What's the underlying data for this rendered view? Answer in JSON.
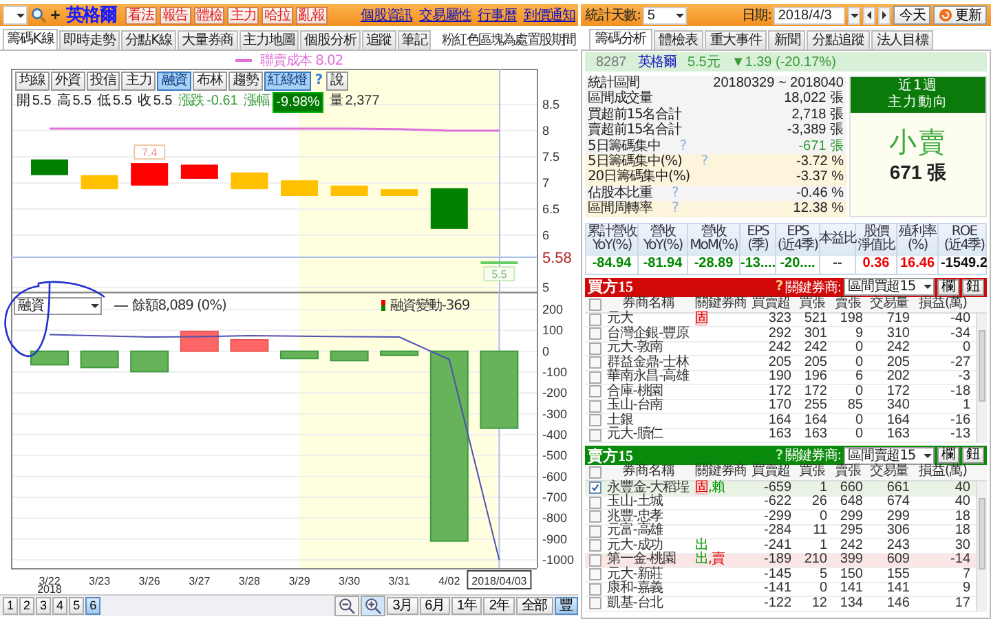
{
  "left": {
    "header": {
      "plus": "+",
      "title": "英格爾",
      "buttons": [
        "看法",
        "報告",
        "體檢",
        "主力",
        "哈拉",
        "亂報"
      ],
      "links": [
        "個股資訊",
        "交易屬性",
        "行事曆",
        "到價通知"
      ]
    },
    "tabs": [
      {
        "label": "籌碼K線",
        "selected": true
      },
      {
        "label": "即時走勢",
        "selected": false
      },
      {
        "label": "分點K線",
        "selected": false
      },
      {
        "label": "大量券商",
        "selected": false
      },
      {
        "label": "主力地圖",
        "selected": false
      },
      {
        "label": "個股分析",
        "selected": false
      },
      {
        "label": "追蹤",
        "selected": false
      },
      {
        "label": "筆記",
        "selected": false
      }
    ],
    "note": "粉紅色區塊為處置股期間",
    "legend": "聯賣成本 8.02",
    "chart_buttons": [
      {
        "label": "均線",
        "selected": false
      },
      {
        "label": "外資",
        "selected": false
      },
      {
        "label": "投信",
        "selected": false
      },
      {
        "label": "主力",
        "selected": false
      },
      {
        "label": "融資",
        "selected": true
      },
      {
        "label": "布林",
        "selected": false
      },
      {
        "label": "趨勢",
        "selected": false
      },
      {
        "label": "紅綠燈",
        "selected": true
      },
      {
        "label": "?",
        "kind": "help"
      },
      {
        "label": "說",
        "selected": false
      }
    ],
    "quote": [
      {
        "label": "開",
        "value": "5.5",
        "kind": "plain"
      },
      {
        "label": "高",
        "value": "5.5",
        "kind": "plain"
      },
      {
        "label": "低",
        "value": "5.5",
        "kind": "plain"
      },
      {
        "label": "收",
        "value": "5.5",
        "kind": "plain"
      },
      {
        "label": "漲跌",
        "value": "-0.61",
        "kind": "down"
      },
      {
        "label": "漲幅",
        "value": "-9.98%",
        "kind": "down_box"
      },
      {
        "label": "量",
        "value": "2,377",
        "kind": "volume"
      }
    ],
    "price_chart": {
      "axis_labels": [
        "8.5",
        "8",
        "7.5",
        "7",
        "6.5",
        "6",
        "5"
      ],
      "high_tag": "7.4",
      "last_tag": "5.5",
      "price_line": "5.58"
    },
    "margin_chart": {
      "select": "融資",
      "balance": "8,089 (0%)",
      "change": "-369",
      "chart_data": {
        "type": "bar",
        "categories": [
          "3/22",
          "3/23",
          "3/26",
          "3/27",
          "3/28",
          "3/29",
          "3/30",
          "3/31",
          "4/02",
          "2018/04/03"
        ],
        "series": [
          {
            "name": "融資變動",
            "colors": [
              "#66b35a",
              "#66b35a",
              "#66b35a",
              "#ff6666",
              "#ff6666",
              "#66b35a",
              "#66b35a",
              "#66b35a",
              "#66b35a",
              "#66b35a"
            ],
            "values": [
              -65,
              -78,
              -98,
              95,
              55,
              -35,
              -45,
              -20,
              -910,
              -369
            ]
          },
          {
            "name": "餘額",
            "type": "line",
            "color": "#5050b0",
            "values": [
              80,
              74,
              68,
              70,
              75,
              72,
              70,
              68,
              -40,
              -1000
            ]
          }
        ],
        "grid": true,
        "bands": [
          {
            "axis": "x",
            "from": "3/29",
            "to": "2018/04/03",
            "color": "#ffffe0"
          }
        ],
        "ref_lines": [
          {
            "axis": "x",
            "value": "2018/04/03",
            "color": "#a8c0e8"
          }
        ],
        "ylim": [
          -1000,
          200
        ],
        "yticks": [
          200,
          100,
          0,
          -100,
          -200,
          -300,
          -400,
          -500,
          -600,
          -700,
          -800,
          -900,
          -1000
        ]
      },
      "year": "2018"
    },
    "pages": [
      {
        "label": "1",
        "selected": false
      },
      {
        "label": "2",
        "selected": false
      },
      {
        "label": "3",
        "selected": false
      },
      {
        "label": "4",
        "selected": false
      },
      {
        "label": "5",
        "selected": false
      },
      {
        "label": "6",
        "selected": true
      }
    ],
    "ranges": [
      {
        "label": "3月",
        "selected": false
      },
      {
        "label": "6月",
        "selected": false
      },
      {
        "label": "1年",
        "selected": false
      },
      {
        "label": "2年",
        "selected": false
      },
      {
        "label": "全部",
        "selected": false
      },
      {
        "label": "豐",
        "selected": true
      }
    ]
  },
  "right": {
    "days_label": "統計天數:",
    "days": "5",
    "date_label": "日期:",
    "date": "2018/4/3",
    "today": "今天",
    "refresh": "更新",
    "tabs": [
      {
        "label": "籌碼分析",
        "selected": true
      },
      {
        "label": "體檢表",
        "selected": false
      },
      {
        "label": "重大事件",
        "selected": false
      },
      {
        "label": "新聞",
        "selected": false
      },
      {
        "label": "分點追蹤",
        "selected": false
      },
      {
        "label": "法人目標",
        "selected": false
      }
    ],
    "stock": {
      "code": "8287",
      "name": "英格爾",
      "price": "5.5元",
      "change": "▼1.39 (-20.17%)"
    },
    "stats": [
      {
        "label": "統計區間",
        "value": "20180329 ~ 2018040",
        "highlight": false,
        "color": "#222222"
      },
      {
        "label": "區間成交量",
        "value": "18,022 張",
        "highlight": false,
        "color": "#222222"
      },
      {
        "label": "買超前15名合計",
        "value": "2,718 張",
        "highlight": false,
        "color": "#222222"
      },
      {
        "label": "賣超前15名合計",
        "value": "-3,389 張",
        "highlight": false,
        "color": "#222222"
      },
      {
        "label": "5日籌碼集中",
        "help": "?",
        "value": "-671 張",
        "highlight": false,
        "color": "#339933"
      },
      {
        "label": "5日籌碼集中(%)",
        "help": "?",
        "value": "-3.72 %",
        "highlight": true,
        "color": "#222222"
      },
      {
        "label": "20日籌碼集中(%)",
        "value": "-3.37 %",
        "highlight": true,
        "color": "#222222"
      },
      {
        "label": "佔股本比重",
        "help": "?",
        "value": "-0.46 %",
        "highlight": false,
        "color": "#222222"
      },
      {
        "label": "區間周轉率",
        "help": "?",
        "value": "12.38 %",
        "highlight": true,
        "color": "#222222"
      }
    ],
    "trend": {
      "period": "近1週",
      "title": "主力動向",
      "verdict": "小賣",
      "amount": "671 張"
    },
    "fundamentals": [
      {
        "header": [
          "累計營收",
          "YoY(%)"
        ],
        "value": "-84.94",
        "color": "#008800"
      },
      {
        "header": [
          "營收",
          "YoY(%)"
        ],
        "value": "-81.94",
        "color": "#008800"
      },
      {
        "header": [
          "營收",
          "MoM(%)"
        ],
        "value": "-28.89",
        "color": "#008800"
      },
      {
        "header": [
          "EPS",
          "(季)"
        ],
        "value": "-13....",
        "color": "#008800"
      },
      {
        "header": [
          "EPS",
          "(近4季)"
        ],
        "value": "-20....",
        "color": "#008800"
      },
      {
        "header": [
          "本益比"
        ],
        "value": "--",
        "color": "#444444"
      },
      {
        "header": [
          "股價",
          "淨值比"
        ],
        "value": "0.36",
        "color": "#ee0000"
      },
      {
        "header": [
          "殖利率",
          "(%)"
        ],
        "value": "16.46",
        "color": "#ee0000"
      },
      {
        "header": [
          "ROE",
          "(近4季)"
        ],
        "value": "-1549.2",
        "color": "#111111"
      }
    ],
    "tables": [
      {
        "kind": "buy",
        "title": "買方15",
        "help": "?",
        "key_label": "關鍵券商:",
        "select": "區間買超15",
        "buttons": [
          "欄",
          "鈕"
        ],
        "header_checked": false,
        "columns": [
          "券商名稱",
          "關鍵券商",
          "買賣超",
          "買張",
          "賣張",
          "交易量",
          "損益(萬)"
        ],
        "rows": [
          {
            "name": "元大",
            "tags": [
              {
                "text": "固",
                "color": "#e00000"
              }
            ],
            "net": "323",
            "buy": "521",
            "sell": "198",
            "volume": "719",
            "pnl": "-40",
            "checked": false
          },
          {
            "name": "台灣企銀-豐原",
            "net": "292",
            "buy": "301",
            "sell": "9",
            "volume": "310",
            "pnl": "-34",
            "checked": false
          },
          {
            "name": "元大-敦南",
            "net": "242",
            "buy": "242",
            "sell": "0",
            "volume": "242",
            "pnl": "0",
            "checked": false
          },
          {
            "name": "群益金鼎-士林",
            "net": "205",
            "buy": "205",
            "sell": "0",
            "volume": "205",
            "pnl": "-27",
            "checked": false
          },
          {
            "name": "華南永昌-高雄",
            "net": "190",
            "buy": "196",
            "sell": "6",
            "volume": "202",
            "pnl": "-3",
            "checked": false
          },
          {
            "name": "合庫-桃園",
            "net": "172",
            "buy": "172",
            "sell": "0",
            "volume": "172",
            "pnl": "-18",
            "checked": false
          },
          {
            "name": "玉山-台南",
            "net": "170",
            "buy": "255",
            "sell": "85",
            "volume": "340",
            "pnl": "1",
            "checked": false
          },
          {
            "name": "土銀",
            "net": "164",
            "buy": "164",
            "sell": "0",
            "volume": "164",
            "pnl": "-16",
            "checked": false
          },
          {
            "name": "元大-贖仁",
            "net": "163",
            "buy": "163",
            "sell": "0",
            "volume": "163",
            "pnl": "-13",
            "checked": false
          }
        ]
      },
      {
        "kind": "sell",
        "title": "賣方15",
        "help": "?",
        "key_label": "關鍵券商:",
        "select": "區間賣超15",
        "buttons": [
          "欄",
          "鈕"
        ],
        "header_checked": false,
        "columns": [
          "券商名稱",
          "關鍵券商",
          "買賣超",
          "買張",
          "賣張",
          "交易量",
          "損益(萬)"
        ],
        "rows": [
          {
            "name": "永豐金-大稻埕",
            "tags": [
              {
                "text": "固",
                "color": "#e00000"
              },
              {
                "text": ",賴",
                "color": "#009900"
              }
            ],
            "net": "-659",
            "buy": "1",
            "sell": "660",
            "volume": "661",
            "pnl": "40",
            "checked": true,
            "color": "#e8f3e4"
          },
          {
            "name": "玉山-土城",
            "net": "-622",
            "buy": "26",
            "sell": "648",
            "volume": "674",
            "pnl": "40",
            "checked": false
          },
          {
            "name": "兆豐-忠孝",
            "net": "-299",
            "buy": "0",
            "sell": "299",
            "volume": "299",
            "pnl": "18",
            "checked": false
          },
          {
            "name": "元富-高雄",
            "net": "-284",
            "buy": "11",
            "sell": "295",
            "volume": "306",
            "pnl": "18",
            "checked": false
          },
          {
            "name": "元大-成功",
            "tags": [
              {
                "text": "出",
                "color": "#009900"
              }
            ],
            "net": "-241",
            "buy": "1",
            "sell": "242",
            "volume": "243",
            "pnl": "30",
            "checked": false
          },
          {
            "name": "第一金-桃園",
            "tags": [
              {
                "text": "出",
                "color": "#009900"
              },
              {
                "text": ",賣",
                "color": "#e00000"
              }
            ],
            "net": "-189",
            "buy": "210",
            "sell": "399",
            "volume": "609",
            "pnl": "-14",
            "checked": false,
            "color": "#fbe6e6"
          },
          {
            "name": "元大-新莊",
            "net": "-145",
            "buy": "5",
            "sell": "150",
            "volume": "155",
            "pnl": "7",
            "checked": false
          },
          {
            "name": "康和-嘉義",
            "net": "-141",
            "buy": "0",
            "sell": "141",
            "volume": "141",
            "pnl": "9",
            "checked": false
          },
          {
            "name": "凱基-台北",
            "net": "-122",
            "buy": "12",
            "sell": "134",
            "volume": "146",
            "pnl": "17",
            "checked": false
          }
        ]
      }
    ]
  }
}
